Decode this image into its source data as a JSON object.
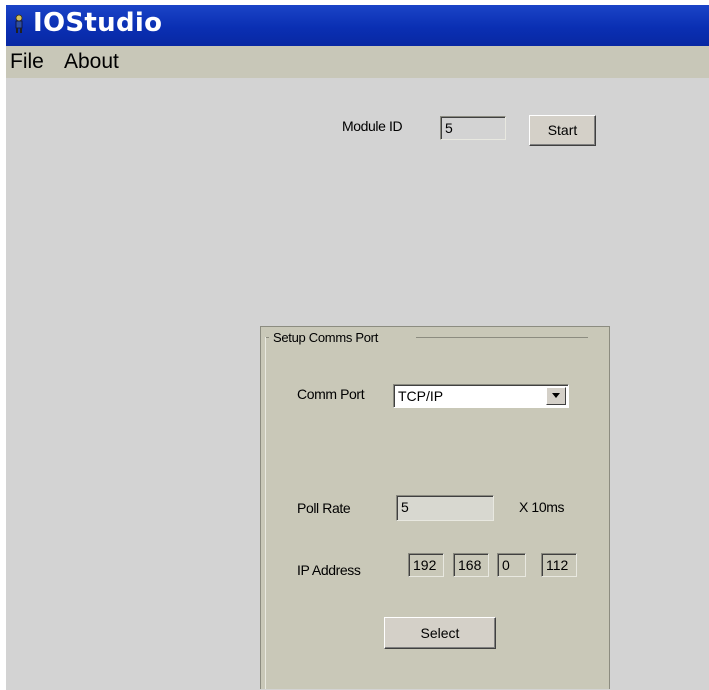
{
  "window": {
    "title": "IOStudio"
  },
  "menu": {
    "items": [
      "File",
      "About"
    ]
  },
  "module": {
    "label": "Module ID",
    "value": "5",
    "start_label": "Start"
  },
  "setup": {
    "group_title": "Setup Comms Port",
    "comm_port_label": "Comm Port",
    "comm_port_value": "TCP/IP",
    "poll_rate_label": "Poll Rate",
    "poll_rate_value": "5",
    "poll_rate_unit": "X 10ms",
    "ip_label": "IP Address",
    "ip_octets": [
      "192",
      "168",
      "0",
      "112"
    ],
    "select_label": "Select"
  },
  "icons": {
    "app": "person-icon",
    "dropdown": "chevron-down-icon"
  },
  "colors": {
    "titlebar": "#0a2fb3",
    "menubar": "#c8c7b8",
    "client": "#d3d3d3",
    "panel": "#c9c8b8"
  }
}
